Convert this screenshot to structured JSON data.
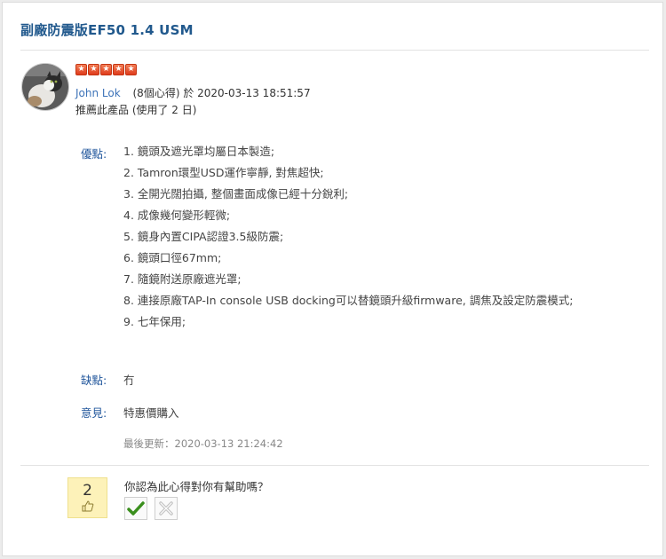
{
  "review": {
    "title": "副廠防震版EF50 1.4 USM",
    "rating_stars": 5,
    "author": "John Lok",
    "post_info": "(8個心得) 於 2020-03-13 18:51:57",
    "recommend_text": "推薦此產品 (使用了 2 日)",
    "pros_label": "優點:",
    "pros": [
      "1. 鏡頭及遮光罩均屬日本製造;",
      "2. Tamron環型USD運作寧靜, 對焦超快;",
      "3. 全開光闊拍攝, 整個畫面成像已經十分銳利;",
      "4. 成像幾何變形輕微;",
      "5. 鏡身內置CIPA認證3.5級防震;",
      "6. 鏡頭口徑67mm;",
      "7. 隨鏡附送原廠遮光罩;",
      "8. 連接原廠TAP-In console USB docking可以替鏡頭升級firmware, 調焦及設定防震模式;",
      "9. 七年保用;"
    ],
    "cons_label": "缺點:",
    "cons": "冇",
    "opinion_label": "意見:",
    "opinion": "特惠價購入",
    "last_updated": "最後更新：2020-03-13 21:24:42"
  },
  "helpful": {
    "count": "2",
    "question": "你認為此心得對你有幫助嗎？"
  },
  "icons": {
    "star": "star-icon",
    "thumb": "thumbs-up-icon",
    "yes": "checkmark-icon",
    "no": "cross-icon"
  },
  "colors": {
    "title": "#21598d",
    "label": "#22579c",
    "username": "#3d73b8",
    "star": "#e0481f",
    "vote_box": "#fdf2b9",
    "check": "#3a8f1d"
  }
}
